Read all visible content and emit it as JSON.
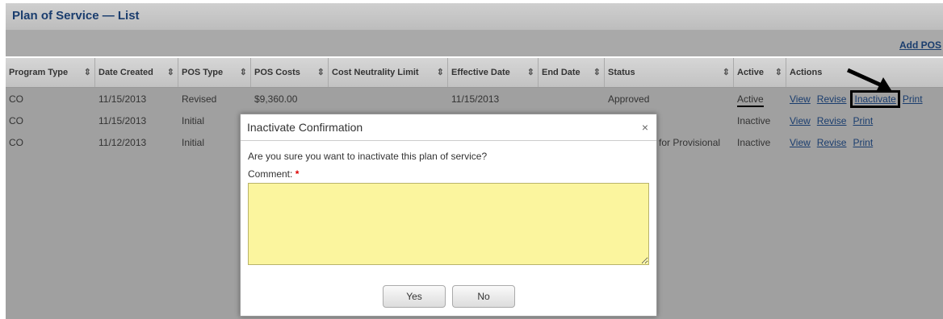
{
  "page": {
    "title": "Plan of Service — List",
    "add_pos": "Add POS"
  },
  "columns": [
    {
      "label": "Program Type",
      "sort": "⇕"
    },
    {
      "label": "Date Created",
      "sort": "⇕"
    },
    {
      "label": "POS Type",
      "sort": "⇕"
    },
    {
      "label": "POS Costs",
      "sort": "⇕"
    },
    {
      "label": "Cost Neutrality Limit",
      "sort": "⇕"
    },
    {
      "label": "Effective Date",
      "sort": "⇕"
    },
    {
      "label": "End Date",
      "sort": "⇕"
    },
    {
      "label": "Status",
      "sort": "⇕"
    },
    {
      "label": "Active",
      "sort": "⇕"
    },
    {
      "label": "Actions",
      "sort": ""
    }
  ],
  "rows": [
    {
      "program_type": "CO",
      "date_created": "11/15/2013",
      "pos_type": "Revised",
      "pos_costs": "$9,360.00",
      "effective_date": "11/15/2013",
      "status": "Approved",
      "active": "Active",
      "actions": [
        "View",
        "Revise",
        "Inactivate",
        "Print"
      ]
    },
    {
      "program_type": "CO",
      "date_created": "11/15/2013",
      "pos_type": "Initial",
      "pos_costs": "",
      "effective_date": "",
      "status": "",
      "active": "Inactive",
      "actions": [
        "View",
        "Revise",
        "Print"
      ]
    },
    {
      "program_type": "CO",
      "date_created": "11/12/2013",
      "pos_type": "Initial",
      "pos_costs": "",
      "effective_date": "",
      "status": "for Provisional",
      "active": "Inactive",
      "actions": [
        "View",
        "Revise",
        "Print"
      ]
    }
  ],
  "modal": {
    "title": "Inactivate Confirmation",
    "close": "×",
    "question": "Are you sure you want to inactivate this plan of service?",
    "comment_label": "Comment:",
    "required_mark": "*",
    "comment_value": "",
    "yes": "Yes",
    "no": "No"
  },
  "colors": {
    "title": "#1a3d6e",
    "comment_bg": "#fbf59e",
    "link": "#1a3d6e"
  }
}
